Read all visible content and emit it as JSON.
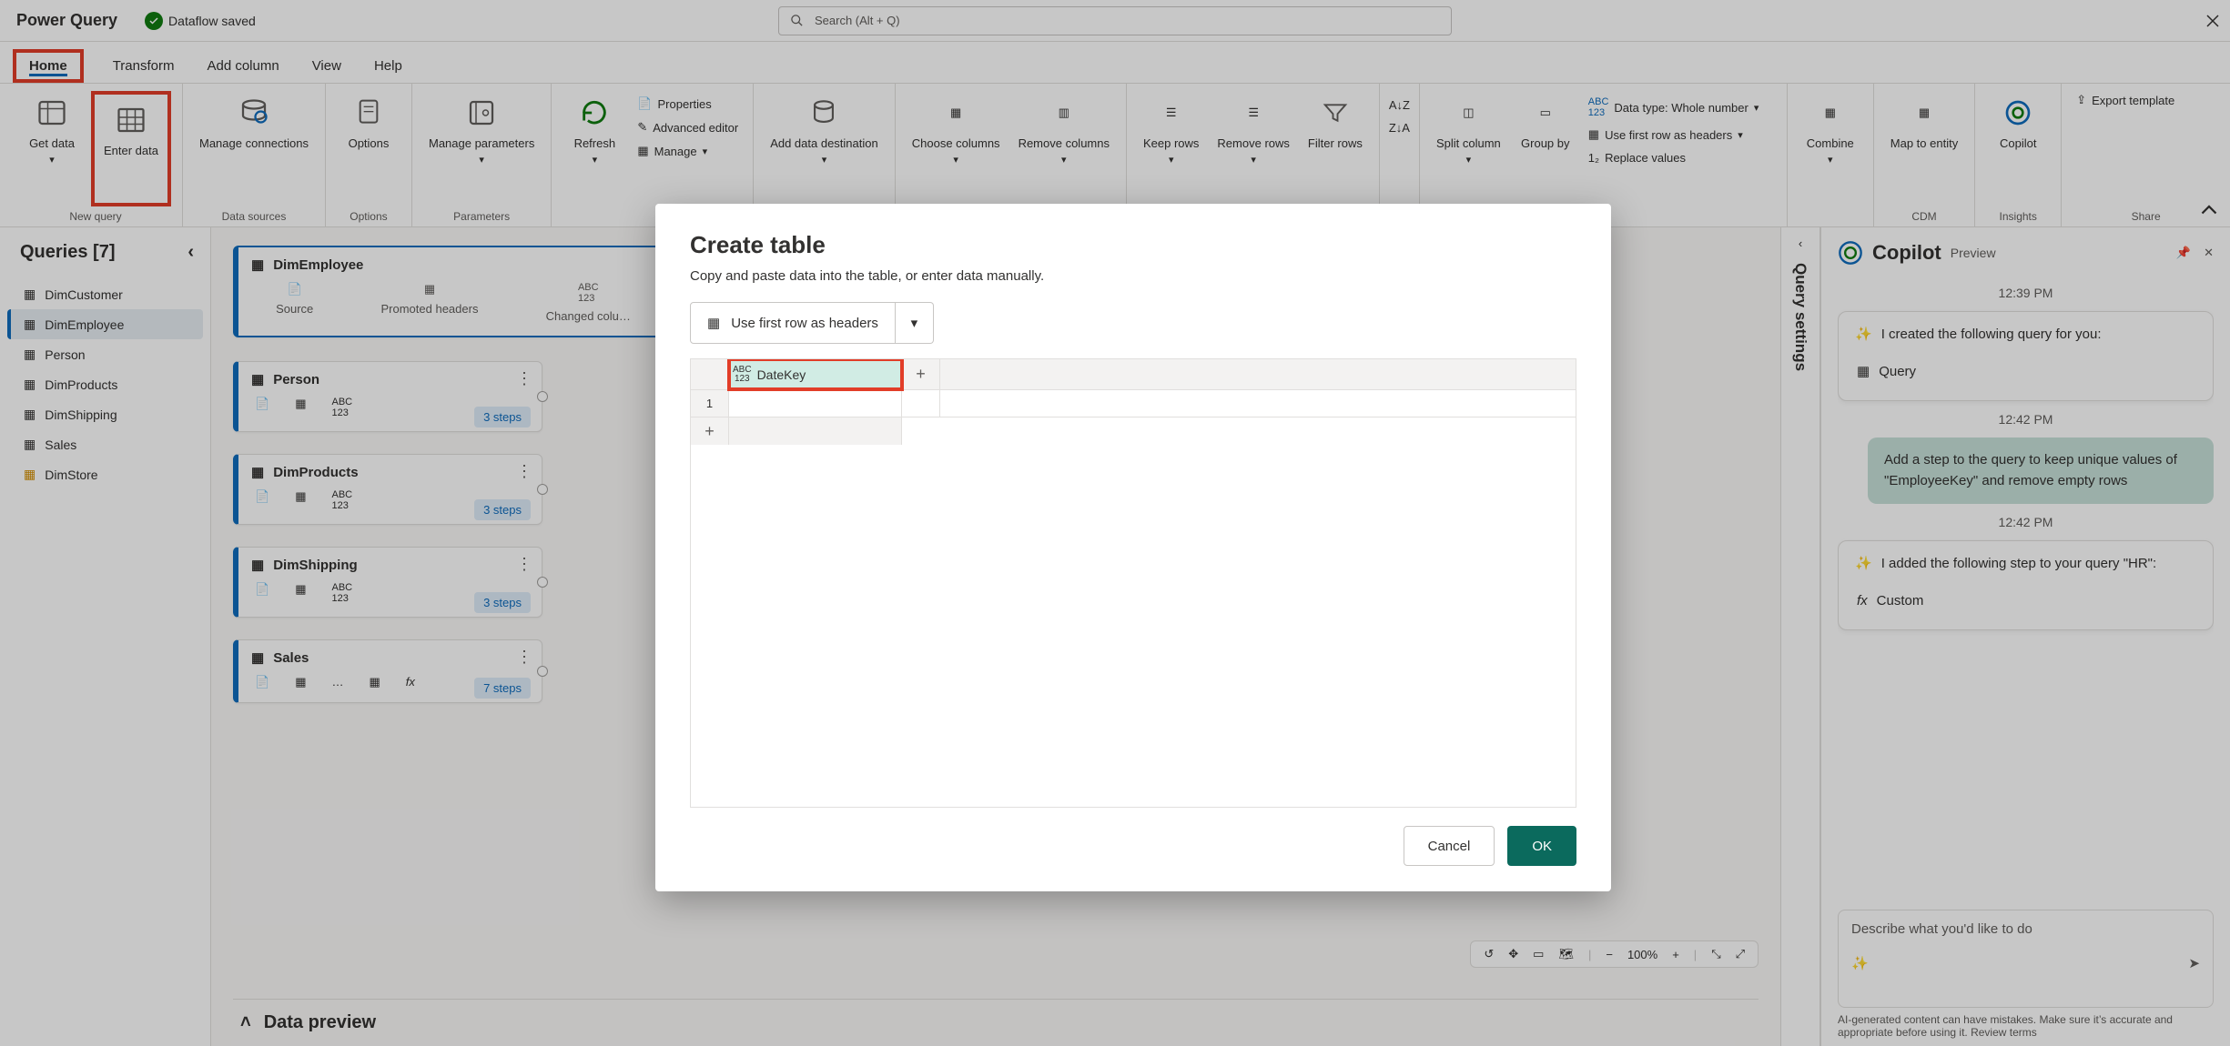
{
  "app": {
    "title": "Power Query",
    "save_status": "Dataflow saved"
  },
  "search": {
    "placeholder": "Search (Alt + Q)"
  },
  "tabs": {
    "home": "Home",
    "transform": "Transform",
    "add_column": "Add column",
    "view": "View",
    "help": "Help"
  },
  "ribbon": {
    "new_query": {
      "label": "New query",
      "get_data": "Get data",
      "enter_data": "Enter data"
    },
    "data_sources": {
      "label": "Data sources",
      "manage_connections": "Manage connections"
    },
    "options": {
      "label": "Options",
      "options_btn": "Options"
    },
    "parameters": {
      "label": "Parameters",
      "manage_parameters": "Manage parameters"
    },
    "query": {
      "refresh": "Refresh",
      "properties": "Properties",
      "advanced_editor": "Advanced editor",
      "manage": "Manage"
    },
    "add_data_destination": "Add data destination",
    "columns": {
      "choose": "Choose columns",
      "remove": "Remove columns"
    },
    "rows": {
      "keep": "Keep rows",
      "remove": "Remove rows",
      "filter": "Filter rows"
    },
    "sort_az": "A→Z",
    "sort_za": "Z→A",
    "split_column": "Split column",
    "group_by": "Group by",
    "data_type_label": "Data type: Whole number",
    "use_first_row": "Use first row as headers",
    "replace_values": "Replace values",
    "combine": "Combine",
    "map_to_entity": "Map to entity",
    "copilot": "Copilot",
    "export_template": "Export template",
    "cdm": "CDM",
    "insights": "Insights",
    "share": "Share"
  },
  "queries": {
    "title": "Queries [7]",
    "items": [
      {
        "name": "DimCustomer"
      },
      {
        "name": "DimEmployee"
      },
      {
        "name": "Person"
      },
      {
        "name": "DimProducts"
      },
      {
        "name": "DimShipping"
      },
      {
        "name": "Sales"
      },
      {
        "name": "DimStore"
      }
    ]
  },
  "canvas": {
    "dim_employee_card": {
      "title": "DimEmployee",
      "steps": [
        "Source",
        "Promoted headers",
        "Changed colu…"
      ]
    },
    "cards": [
      {
        "title": "Person",
        "steps": "3 steps"
      },
      {
        "title": "DimProducts",
        "steps": "3 steps"
      },
      {
        "title": "DimShipping",
        "steps": "3 steps"
      },
      {
        "title": "Sales",
        "steps": "7 steps"
      }
    ],
    "zoom": "100%",
    "data_preview": "Data preview"
  },
  "qs_rail": {
    "label": "Query settings"
  },
  "copilot": {
    "title": "Copilot",
    "preview": "Preview",
    "t1": "12:39 PM",
    "m1_text": "I created the following query for you:",
    "m1_chip": "Query",
    "t2": "12:42 PM",
    "user_msg": "Add a step to the query to keep unique values of \"EmployeeKey\" and remove empty rows",
    "t3": "12:42 PM",
    "m2_text": "I added the following step to your query \"HR\":",
    "m2_chip": "Custom",
    "input_placeholder": "Describe what you'd like to do",
    "disclaimer": "AI-generated content can have mistakes. Make sure it’s accurate and appropriate before using it. Review terms"
  },
  "modal": {
    "title": "Create table",
    "sub": "Copy and paste data into the table, or enter data manually.",
    "use_first_row": "Use first row as headers",
    "col1_name": "DateKey",
    "row1_num": "1",
    "cancel": "Cancel",
    "ok": "OK"
  }
}
